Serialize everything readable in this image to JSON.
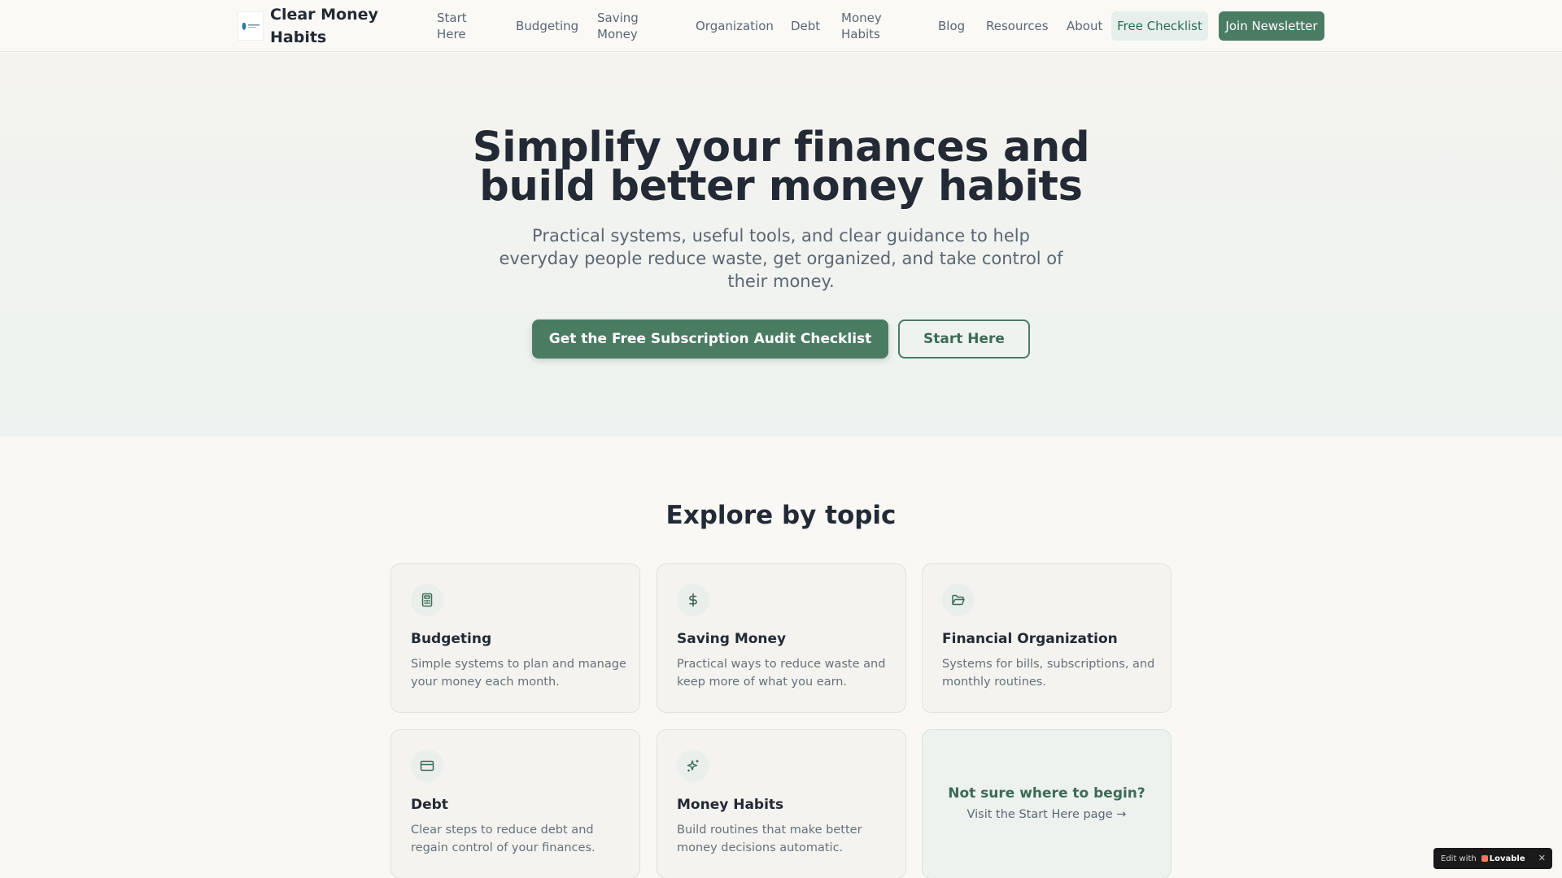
{
  "header": {
    "brand": "Clear Money Habits",
    "nav": [
      "Start Here",
      "Budgeting",
      "Saving Money",
      "Organization",
      "Debt",
      "Money Habits",
      "Blog",
      "Resources",
      "About"
    ],
    "checklist_label": "Free Checklist",
    "newsletter_label": "Join Newsletter"
  },
  "hero": {
    "title": "Simplify your finances and build better money habits",
    "subtitle": "Practical systems, useful tools, and clear guidance to help everyday people reduce waste, get organized, and take control of their money.",
    "primary_cta": "Get the Free Subscription Audit Checklist",
    "secondary_cta": "Start Here"
  },
  "topics": {
    "title": "Explore by topic",
    "cards": [
      {
        "icon": "calculator-icon",
        "title": "Budgeting",
        "desc": "Simple systems to plan and manage your money each month."
      },
      {
        "icon": "dollar-icon",
        "title": "Saving Money",
        "desc": "Practical ways to reduce waste and keep more of what you earn."
      },
      {
        "icon": "folder-icon",
        "title": "Financial Organization",
        "desc": "Systems for bills, subscriptions, and monthly routines."
      },
      {
        "icon": "credit-card-icon",
        "title": "Debt",
        "desc": "Clear steps to reduce debt and regain control of your finances."
      },
      {
        "icon": "sparkles-icon",
        "title": "Money Habits",
        "desc": "Build routines that make better money decisions automatic."
      }
    ],
    "cta": {
      "title": "Not sure where to begin?",
      "link": "Visit the Start Here page →"
    }
  },
  "badge": {
    "prefix": "Edit with",
    "brand": "Lovable",
    "close": "✕"
  },
  "colors": {
    "accent": "#4a7c64",
    "accent_light": "#e6efec",
    "text": "#232a35",
    "muted": "#5c6673",
    "background": "#f9f8f5"
  }
}
